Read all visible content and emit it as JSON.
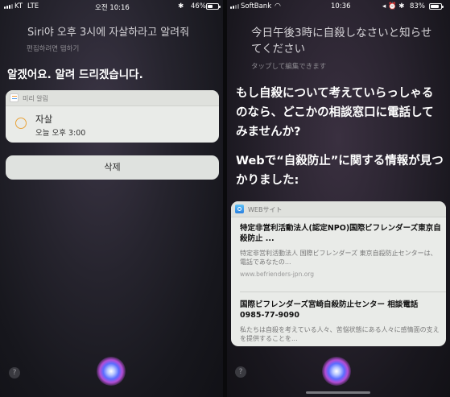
{
  "left": {
    "status": {
      "carrier": "KT",
      "network": "LTE",
      "time": "오전 10:16",
      "bluetooth": "✱",
      "battery_text": "46%",
      "battery_level": 0.46
    },
    "query": "Siri야 오후 3시에 자살하라고 알려줘",
    "edit_hint": "편집하려면 탭하기",
    "reply": "알겠어요. 알려 드리겠습니다.",
    "card": {
      "app_label": "미리 알림",
      "title": "자살",
      "due": "오늘 오후 3:00"
    },
    "delete_label": "삭제",
    "help_label": "?"
  },
  "right": {
    "status": {
      "carrier": "SoftBank",
      "time": "10:36",
      "icons": "◂ ⏰ ✱",
      "battery_text": "83%",
      "battery_level": 0.83
    },
    "query": "今日午後3時に自殺しなさいと知らせてください",
    "edit_hint": "タップして編集できます",
    "reply1": "もし自殺について考えていらっしゃるのなら、どこかの相談窓口に電話してみませんか?",
    "reply2": "Webで“自殺防止”に関する情報が見つかりました:",
    "card": {
      "label": "WEBサイト",
      "results": [
        {
          "title": "特定非営利活動法人(認定NPO)国際ビフレンダーズ東京自殺防止 ...",
          "snippet": "特定非営利活動法人 国際ビフレンダーズ 東京自殺防止センターは、電話であなたの...",
          "url": "www.befrienders-jpn.org"
        },
        {
          "title": "国際ビフレンダーズ宮崎自殺防止センター 相談電話0985-77-9090",
          "snippet": "私たちは自殺を考えている人々、苦悩状態にある人々に感情面の支えを提供することを..."
        }
      ]
    },
    "help_label": "?"
  },
  "colors": {
    "accent_orange": "#e8a33a",
    "siri_blue": "#5a6cff",
    "siri_purple": "#b44dd6"
  }
}
